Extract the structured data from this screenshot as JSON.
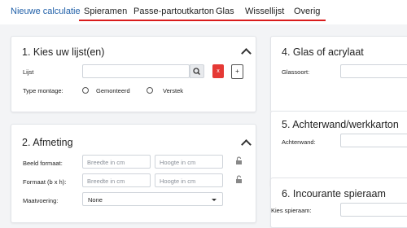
{
  "nav": {
    "tabs": [
      {
        "label": "Nieuwe calculatie"
      },
      {
        "label": "Spieramen"
      },
      {
        "label": "Passe-partoutkarton"
      },
      {
        "label": "Glas"
      },
      {
        "label": "Wissellijst"
      },
      {
        "label": "Overig"
      }
    ],
    "active_color": "#1f5fa8",
    "underline_color": "#d91c1c"
  },
  "card1": {
    "title": "1. Kies uw lijst(en)",
    "lijst_label": "Lijst",
    "lijst_value": "",
    "remove_button": "x",
    "add_button": "+",
    "montage_label": "Type montage:",
    "montage_options": [
      "Gemonteerd",
      "Verstek"
    ]
  },
  "card2": {
    "title": "2. Afmeting",
    "rows": [
      {
        "label": "Beeld formaat:",
        "width_placeholder": "Breedte in cm",
        "height_placeholder": "Hoogte in cm"
      },
      {
        "label": "Formaat (b x h):",
        "width_placeholder": "Breedte in cm",
        "height_placeholder": "Hoogte in cm"
      }
    ],
    "maatvoering_label": "Maatvoering:",
    "maatvoering_value": "None"
  },
  "card4": {
    "title": "4. Glas of acrylaat",
    "label": "Glassoort:"
  },
  "card5": {
    "title": "5. Achterwand/werkkarton",
    "label": "Achterwand:"
  },
  "card6": {
    "title": "6. Incourante spieraam",
    "label": "Kies spieraam:"
  },
  "icons": {
    "search": "search-icon",
    "lock": "unlock-icon",
    "collapse": "chevron-up-icon"
  }
}
